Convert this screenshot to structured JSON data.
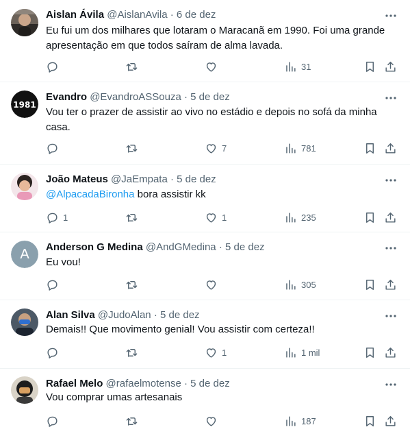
{
  "tweets": [
    {
      "name": "Aislan Ávila",
      "handle": "@AislanAvila",
      "date": "6 de dez",
      "text": "Eu fui um dos milhares que lotaram o Maracanã em 1990. Foi uma grande apresentação em que todos saíram de alma lavada.",
      "replies": "",
      "retweets": "",
      "likes": "",
      "views": "31",
      "avatar_icon": "user-photo-icon"
    },
    {
      "name": "Evandro",
      "handle": "@EvandroASSouza",
      "date": "5 de dez",
      "avatar_text": "1981",
      "text": "Vou ter o prazer de assistir ao vivo no estádio e depois no sofá da minha casa.",
      "replies": "",
      "retweets": "",
      "likes": "7",
      "views": "781"
    },
    {
      "name": "João Mateus",
      "handle": "@JaEmpata",
      "date": "5 de dez",
      "mention": "@AlpacadaBironha",
      "text": " bora assistir kk",
      "replies": "1",
      "retweets": "",
      "likes": "1",
      "views": "235",
      "avatar_icon": "cartoon-avatar-icon"
    },
    {
      "name": "Anderson G Medina",
      "handle": "@AndGMedina",
      "date": "5 de dez",
      "avatar_letter": "A",
      "text": "Eu vou!",
      "replies": "",
      "retweets": "",
      "likes": "",
      "views": "305"
    },
    {
      "name": "Alan Silva",
      "handle": "@JudoAlan",
      "date": "5 de dez",
      "text": "Demais!! Que movimento genial! Vou assistir com certeza!!",
      "replies": "",
      "retweets": "",
      "likes": "1",
      "views": "1 mil",
      "avatar_icon": "masked-person-icon"
    },
    {
      "name": "Rafael Melo",
      "handle": "@rafaelmotense",
      "date": "5 de dez",
      "text": "Vou comprar umas artesanais",
      "replies": "",
      "retweets": "",
      "likes": "",
      "views": "187",
      "avatar_icon": "helmet-person-icon"
    }
  ],
  "colors": {
    "text": "#0f1419",
    "secondary": "#536471",
    "link": "#1d9bf0",
    "divider": "#eff3f4"
  }
}
